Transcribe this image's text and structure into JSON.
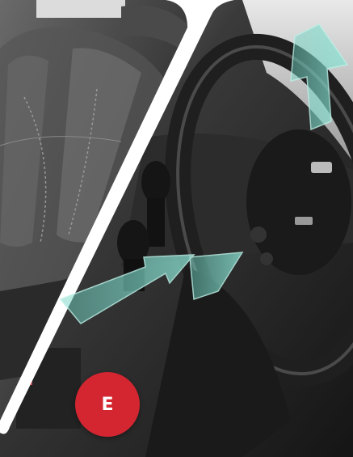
{
  "badge": {
    "label": "E"
  },
  "colors": {
    "badge_red": "#d32630",
    "arrow_teal": "#6fd3c3",
    "seat_dark": "#3a3a3a",
    "interior_dark": "#2a2a2a",
    "background": "#ffffff"
  }
}
